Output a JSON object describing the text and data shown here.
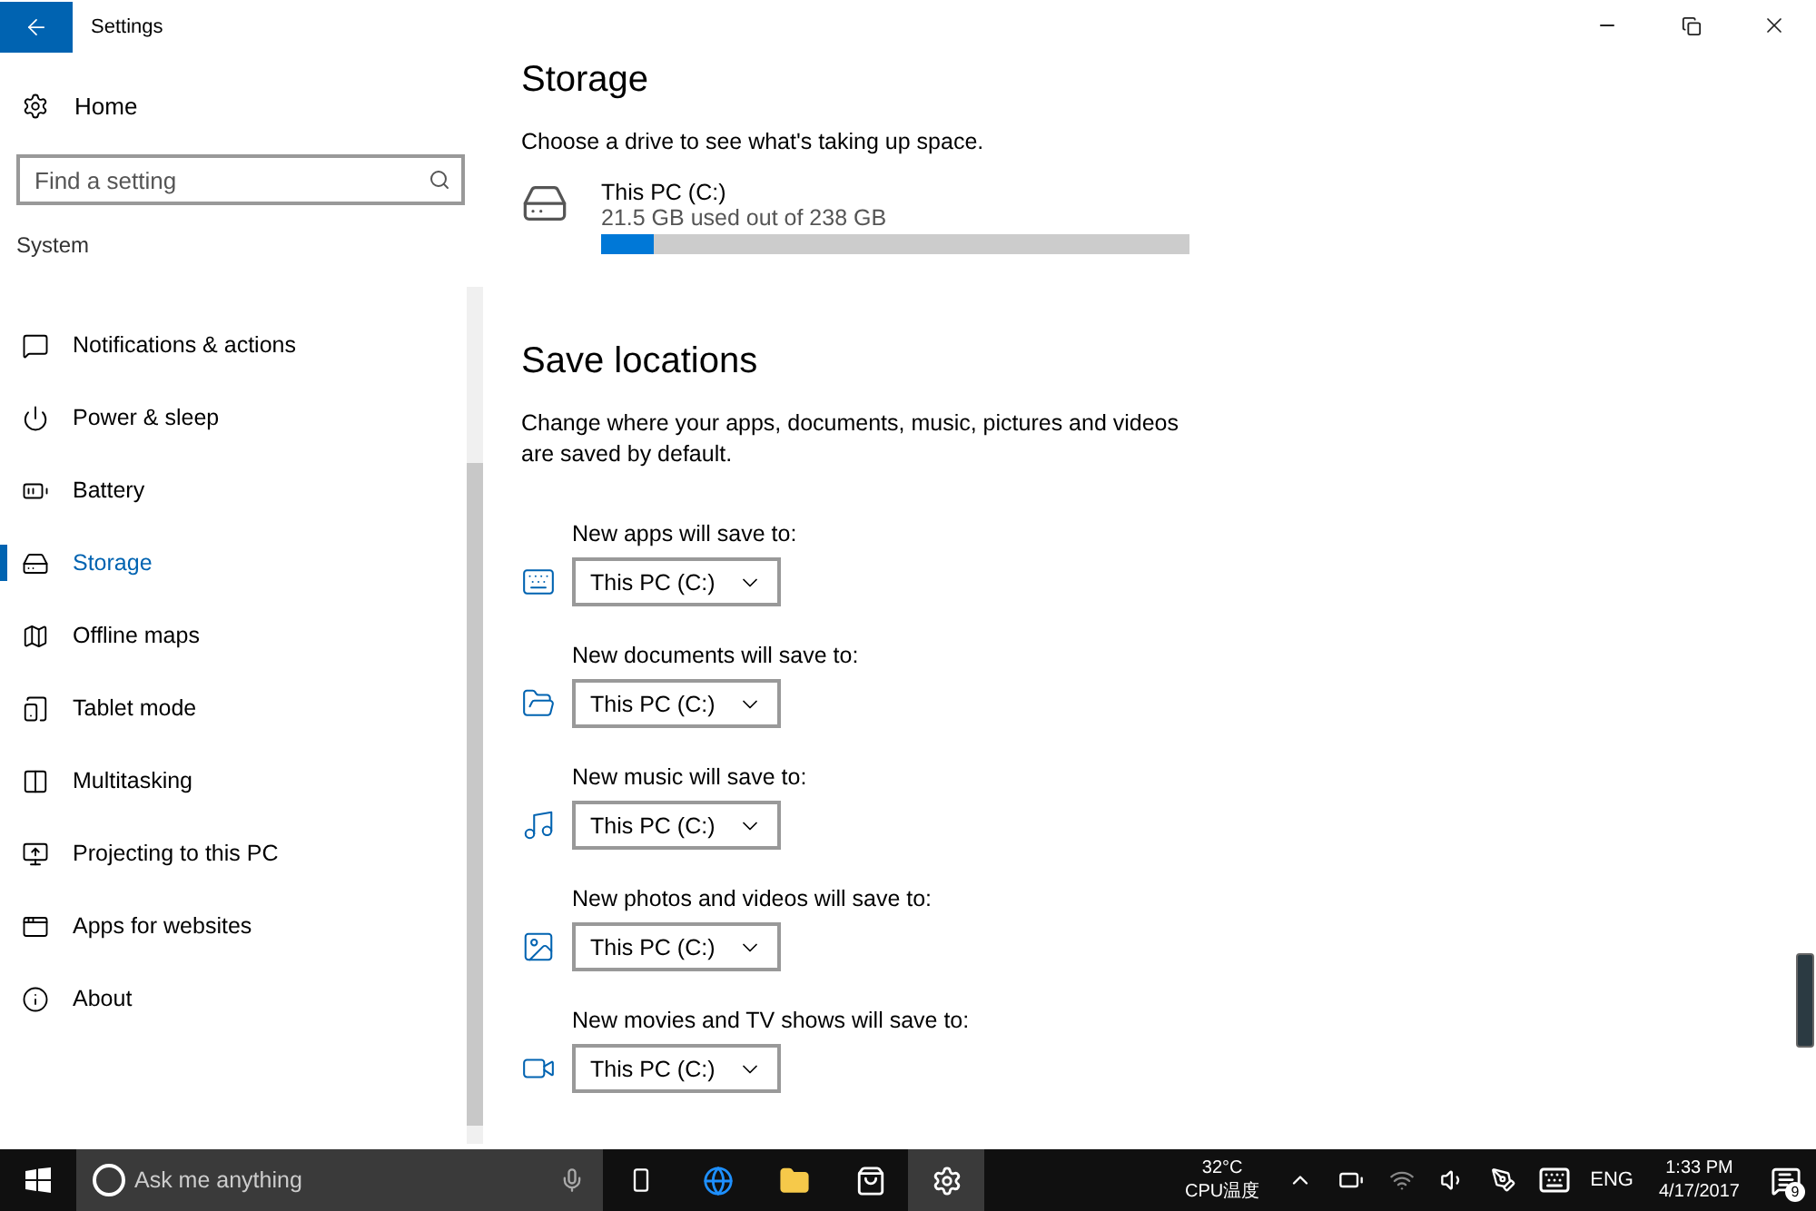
{
  "window": {
    "title": "Settings"
  },
  "sidebar": {
    "home": "Home",
    "search": {
      "placeholder": "Find a setting"
    },
    "section": "System",
    "items": [
      {
        "label": "Notifications & actions",
        "kind": "notifications",
        "selected": false
      },
      {
        "label": "Power & sleep",
        "kind": "power",
        "selected": false
      },
      {
        "label": "Battery",
        "kind": "battery",
        "selected": false
      },
      {
        "label": "Storage",
        "kind": "storage",
        "selected": true
      },
      {
        "label": "Offline maps",
        "kind": "maps",
        "selected": false
      },
      {
        "label": "Tablet mode",
        "kind": "tablet",
        "selected": false
      },
      {
        "label": "Multitasking",
        "kind": "multitasking",
        "selected": false
      },
      {
        "label": "Projecting to this PC",
        "kind": "projecting",
        "selected": false
      },
      {
        "label": "Apps for websites",
        "kind": "websites",
        "selected": false
      },
      {
        "label": "About",
        "kind": "about",
        "selected": false
      }
    ]
  },
  "storage": {
    "title": "Storage",
    "subtitle": "Choose a drive to see what's taking up space.",
    "drive": {
      "name": "This PC (C:)",
      "usage": "21.5 GB used out of 238 GB",
      "level": 0.09
    }
  },
  "save_locations": {
    "title": "Save locations",
    "description": "Change where your apps, documents, music, pictures and videos are saved by default.",
    "items": [
      {
        "label": "New apps will save to:",
        "value": "This PC (C:)",
        "kind": "apps"
      },
      {
        "label": "New documents will save to:",
        "value": "This PC (C:)",
        "kind": "documents"
      },
      {
        "label": "New music will save to:",
        "value": "This PC (C:)",
        "kind": "music"
      },
      {
        "label": "New photos and videos will save to:",
        "value": "This PC (C:)",
        "kind": "photos"
      },
      {
        "label": "New movies and TV shows will save to:",
        "value": "This PC (C:)",
        "kind": "videos"
      }
    ]
  },
  "taskbar": {
    "search": {
      "placeholder": "Ask me anything"
    },
    "temperature": "32°C",
    "sensor": "CPU温度",
    "language": "ENG",
    "time": "1:33 PM",
    "date": "4/17/2017",
    "notifications": "9"
  }
}
